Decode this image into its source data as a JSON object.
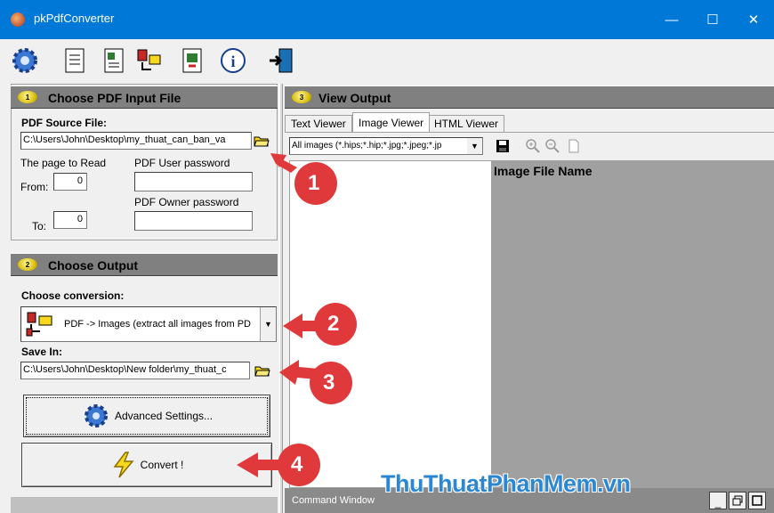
{
  "window": {
    "title": "pkPdfConverter",
    "minimize": "—",
    "maximize": "☐",
    "close": "✕"
  },
  "panel1": {
    "badge": "1",
    "title": "Choose PDF Input File",
    "source_label": "PDF Source File:",
    "source_value": "C:\\Users\\John\\Desktop\\my_thuat_can_ban_va",
    "page_label": "The page to Read",
    "from_label": "From:",
    "from_value": "0",
    "to_label": "To:",
    "to_value": "0",
    "user_pw_label": "PDF User password",
    "owner_pw_label": "PDF Owner  password"
  },
  "panel2": {
    "badge": "2",
    "title": "Choose Output",
    "conversion_label": "Choose conversion:",
    "conversion_value": "PDF -> Images (extract all images from PD",
    "save_label": "Save In:",
    "save_value": "C:\\Users\\John\\Desktop\\New folder\\my_thuat_c",
    "advanced_label": "Advanced Settings...",
    "convert_label": "Convert !"
  },
  "panel3": {
    "badge": "3",
    "title": "View Output",
    "tabs": [
      "Text Viewer",
      "Image Viewer",
      "HTML Viewer"
    ],
    "filter_value": "All images (*.hips;*.hip;*.jpg;*.jpeg;*.jp",
    "column_header": "Image File Name",
    "command_window": "Command Window"
  },
  "callouts": [
    "1",
    "2",
    "3",
    "4"
  ],
  "watermark": "ThuThuatPhanMem.vn",
  "colors": {
    "titlebar": "#0078d7",
    "panel_head": "#808080",
    "callout": "#e0393b",
    "viewer_bg": "#a0a0a0"
  }
}
